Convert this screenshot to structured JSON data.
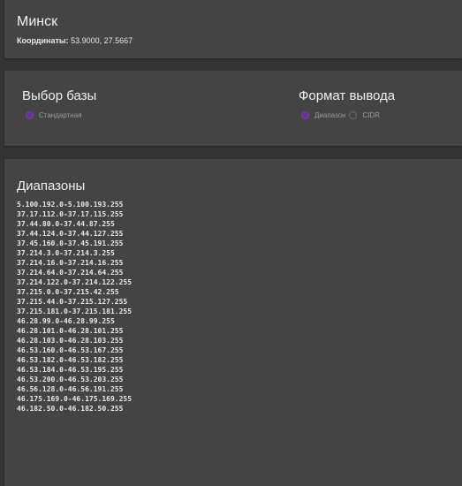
{
  "city": {
    "name": "Минск",
    "coords_label": "Координаты:",
    "coords_value": "53.9000, 27.5667"
  },
  "base": {
    "title": "Выбор базы",
    "option": "Стандартная"
  },
  "format": {
    "title": "Формат вывода",
    "option_range": "Диапазон",
    "option_cidr": "CIDR",
    "selected": "Диапазон"
  },
  "ranges": {
    "title": "Диапазоны",
    "items": [
      "5.100.192.0-5.100.193.255",
      "37.17.112.0-37.17.115.255",
      "37.44.80.0-37.44.87.255",
      "37.44.124.0-37.44.127.255",
      "37.45.160.0-37.45.191.255",
      "37.214.3.0-37.214.3.255",
      "37.214.16.0-37.214.16.255",
      "37.214.64.0-37.214.64.255",
      "37.214.122.0-37.214.122.255",
      "37.215.0.0-37.215.42.255",
      "37.215.44.0-37.215.127.255",
      "37.215.181.0-37.215.181.255",
      "46.28.99.0-46.28.99.255",
      "46.28.101.0-46.28.101.255",
      "46.28.103.0-46.28.103.255",
      "46.53.160.0-46.53.167.255",
      "46.53.182.0-46.53.182.255",
      "46.53.184.0-46.53.195.255",
      "46.53.200.0-46.53.203.255",
      "46.56.128.0-46.56.191.255",
      "46.175.169.0-46.175.169.255",
      "46.182.50.0-46.182.50.255"
    ]
  },
  "colors": {
    "accent": "#6a2f9a",
    "card": "#454445",
    "background": "#363536"
  }
}
